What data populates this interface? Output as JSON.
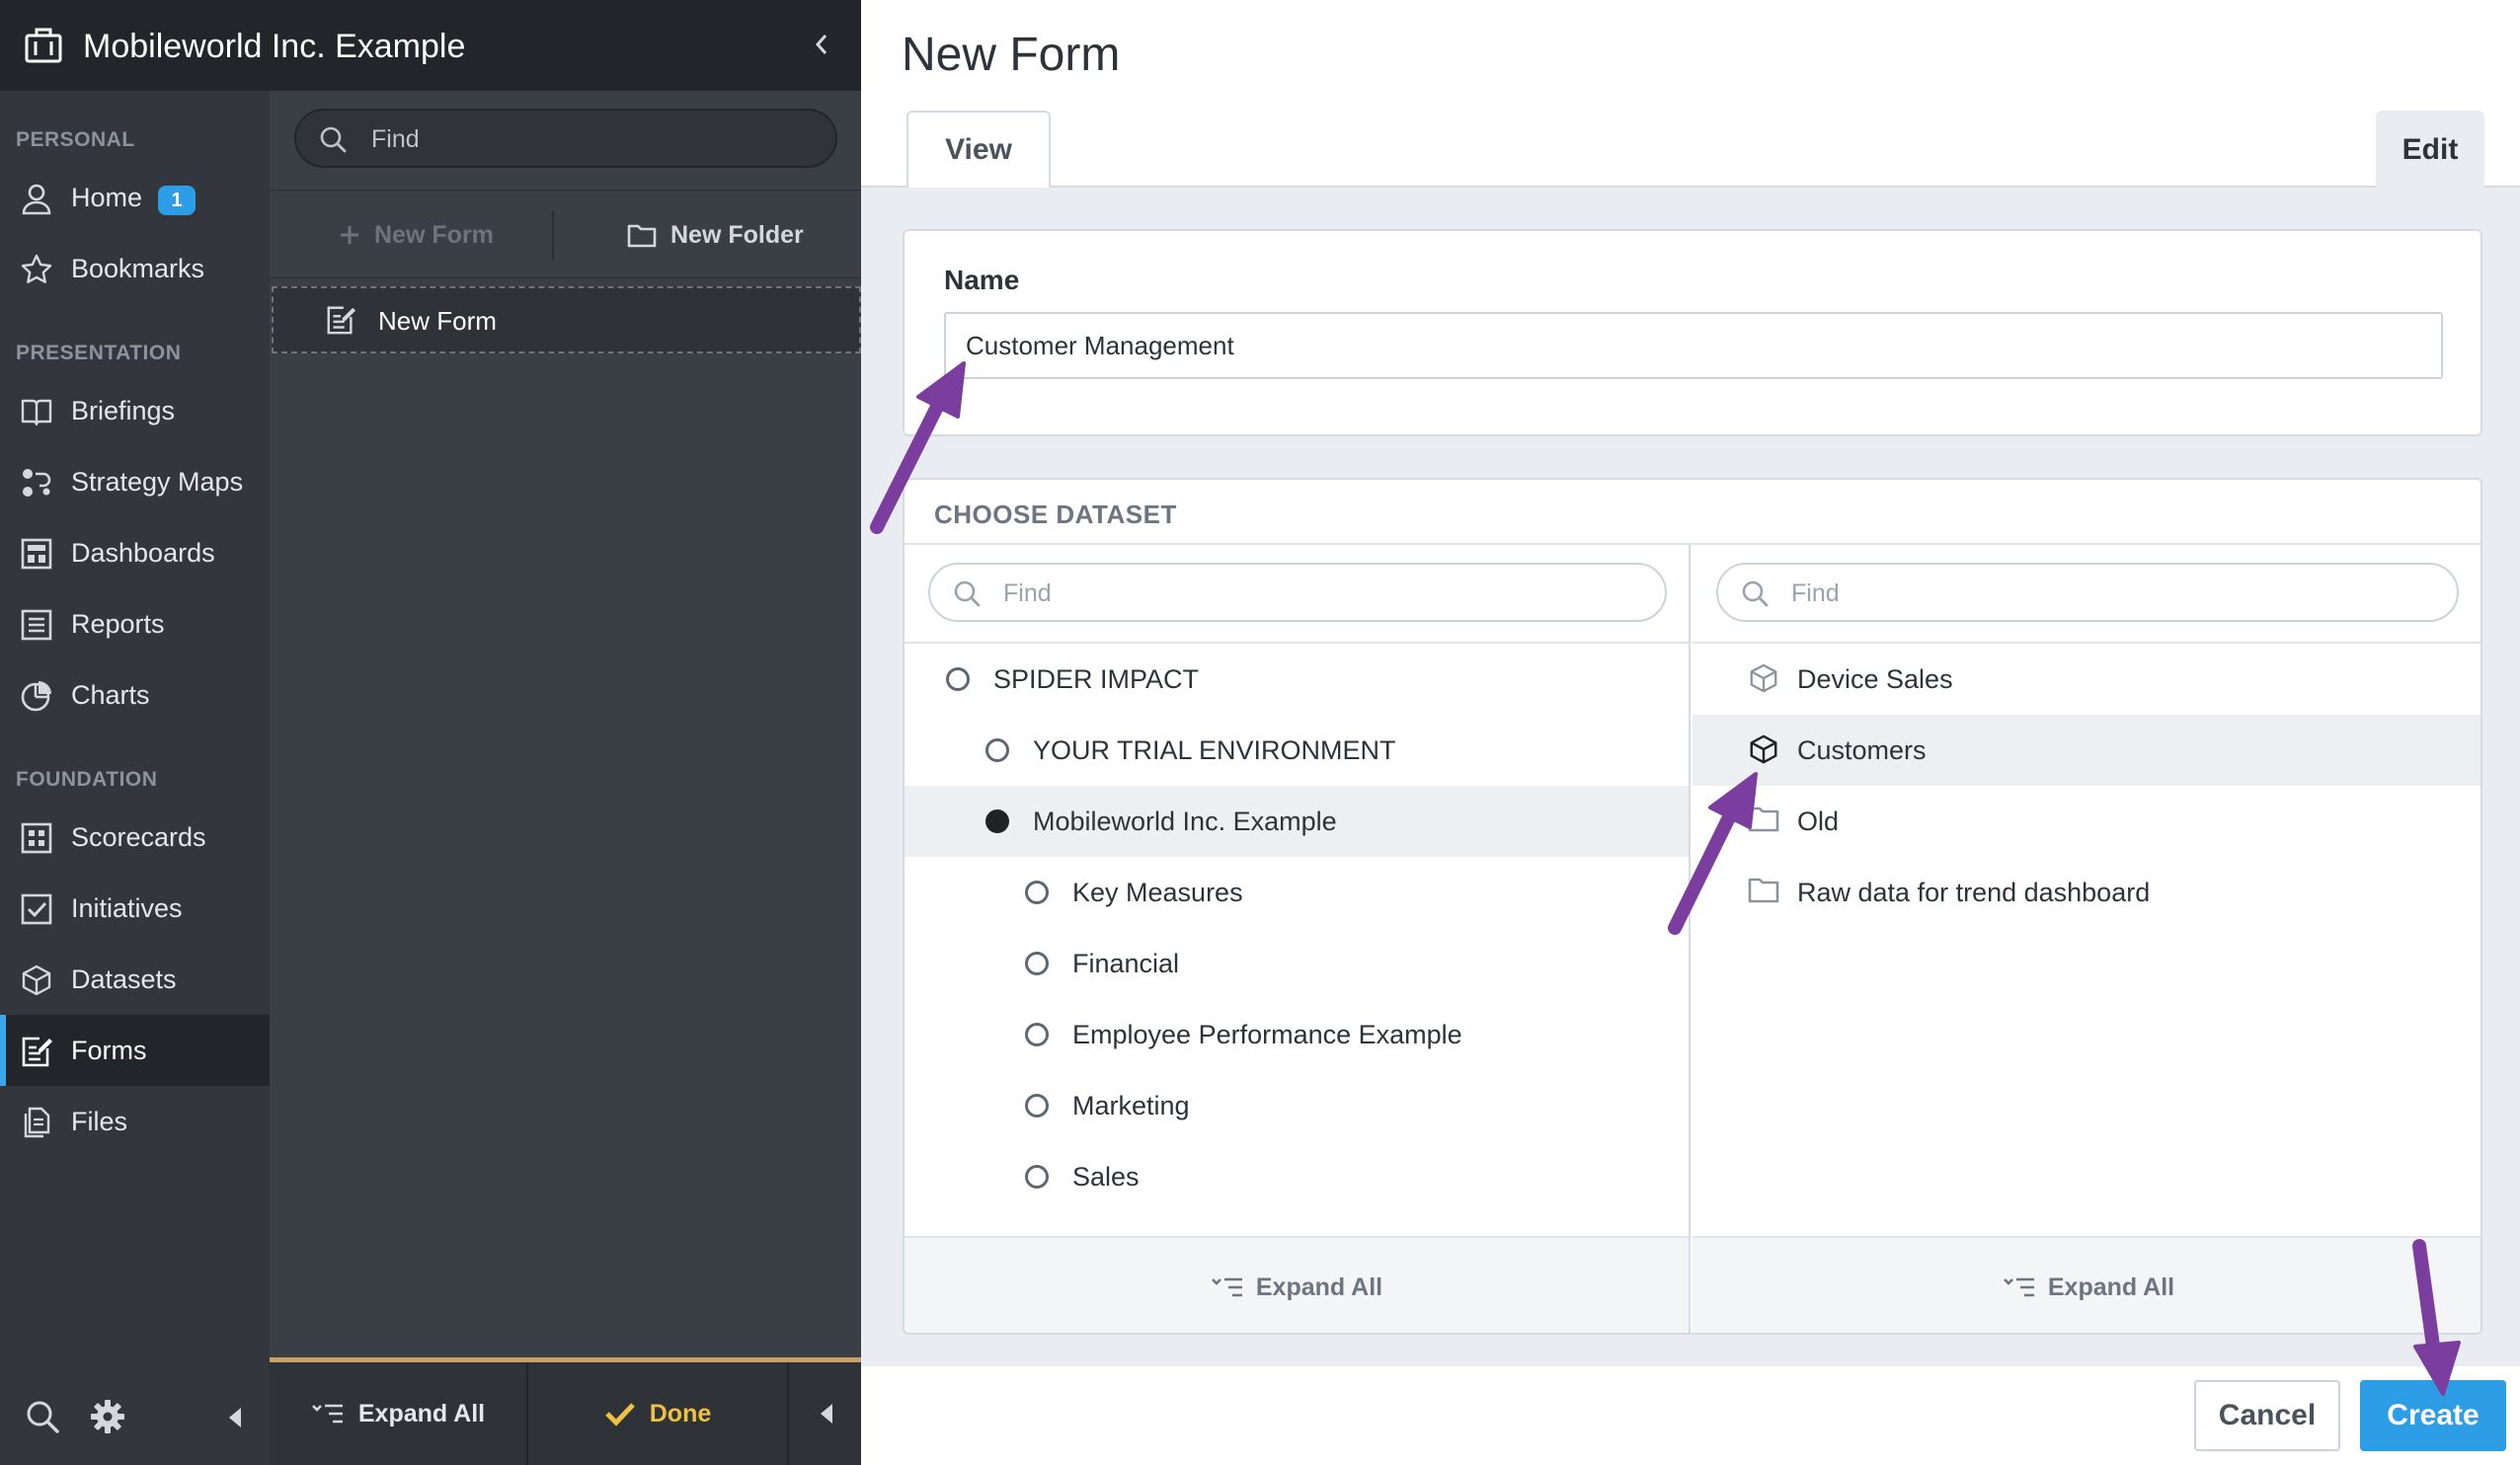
{
  "org": {
    "title": "Mobileworld Inc. Example"
  },
  "nav": {
    "sections": [
      {
        "label": "PERSONAL"
      },
      {
        "label": "PRESENTATION"
      },
      {
        "label": "FOUNDATION"
      }
    ],
    "items": [
      {
        "label": "Home",
        "icon": "user-icon",
        "badge": "1"
      },
      {
        "label": "Bookmarks",
        "icon": "star-icon"
      },
      {
        "label": "Briefings",
        "icon": "book-icon"
      },
      {
        "label": "Strategy Maps",
        "icon": "strategy-map-icon"
      },
      {
        "label": "Dashboards",
        "icon": "dashboard-icon"
      },
      {
        "label": "Reports",
        "icon": "report-icon"
      },
      {
        "label": "Charts",
        "icon": "pie-chart-icon"
      },
      {
        "label": "Scorecards",
        "icon": "scorecard-icon"
      },
      {
        "label": "Initiatives",
        "icon": "checkbox-icon"
      },
      {
        "label": "Datasets",
        "icon": "cube-icon"
      },
      {
        "label": "Forms",
        "icon": "form-icon",
        "active": true
      },
      {
        "label": "Files",
        "icon": "files-icon"
      }
    ]
  },
  "tree": {
    "search_placeholder": "Find",
    "new_form_label": "New Form",
    "new_folder_label": "New Folder",
    "selected_item": "New Form",
    "expand_all_label": "Expand All",
    "done_label": "Done"
  },
  "main": {
    "title": "New Form",
    "tabs": {
      "view": "View",
      "edit": "Edit"
    },
    "name_label": "Name",
    "name_value": "Customer Management",
    "choose_dataset_label": "CHOOSE DATASET",
    "left_search_placeholder": "Find",
    "right_search_placeholder": "Find",
    "left_tree": [
      {
        "label": "SPIDER IMPACT",
        "level": 0,
        "selected": false
      },
      {
        "label": "YOUR TRIAL ENVIRONMENT",
        "level": 1,
        "selected": false
      },
      {
        "label": "Mobileworld Inc. Example",
        "level": 1,
        "selected": true
      },
      {
        "label": "Key Measures",
        "level": 2,
        "selected": false
      },
      {
        "label": "Financial",
        "level": 2,
        "selected": false
      },
      {
        "label": "Employee Performance Example",
        "level": 2,
        "selected": false
      },
      {
        "label": "Marketing",
        "level": 2,
        "selected": false
      },
      {
        "label": "Sales",
        "level": 2,
        "selected": false
      }
    ],
    "right_list": [
      {
        "label": "Device Sales",
        "icon": "cube-icon",
        "selected": false
      },
      {
        "label": "Customers",
        "icon": "cube-icon",
        "selected": true
      },
      {
        "label": "Old",
        "icon": "folder-icon",
        "selected": false
      },
      {
        "label": "Raw data for trend dashboard",
        "icon": "folder-icon",
        "selected": false
      }
    ],
    "expand_all_left": "Expand All",
    "expand_all_right": "Expand All",
    "cancel_label": "Cancel",
    "create_label": "Create"
  },
  "colors": {
    "accent": "#2d9ee6",
    "annotation_arrow": "#7b3d9e",
    "nav_bg": "#33373d",
    "header_bg": "#22252a"
  }
}
